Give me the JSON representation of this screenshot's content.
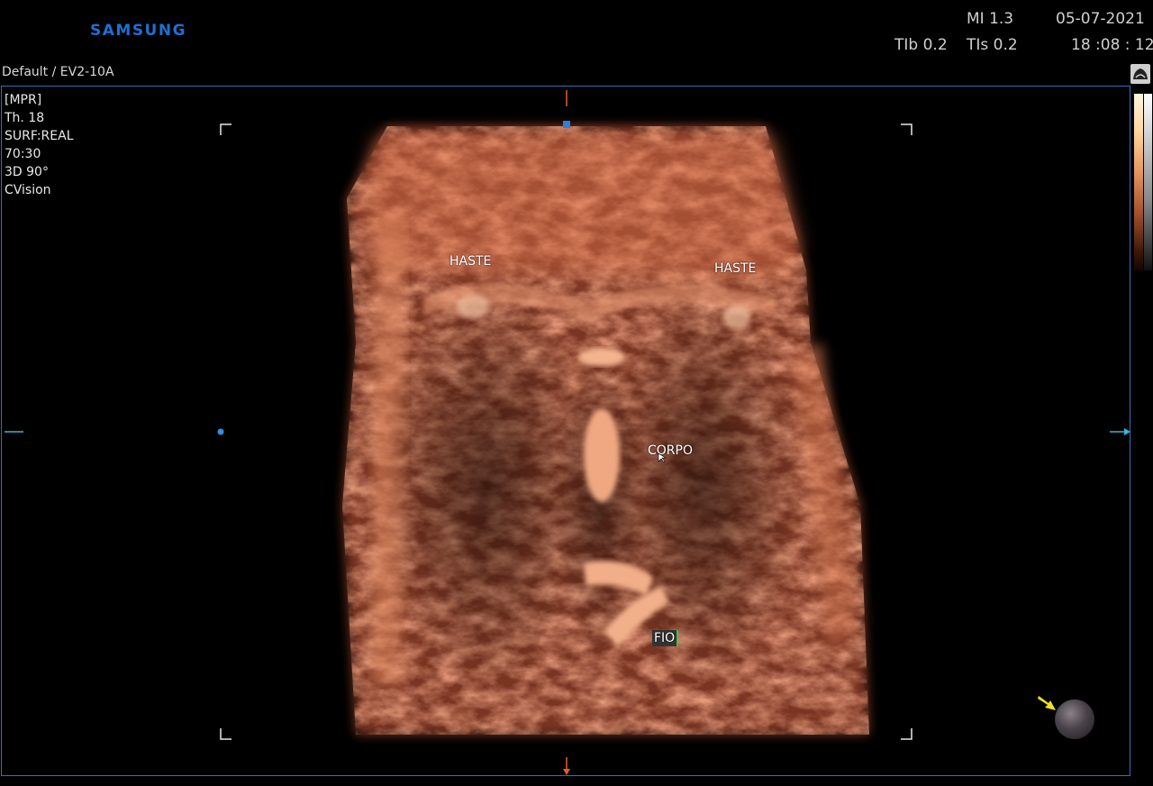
{
  "header": {
    "brand": "SAMSUNG",
    "mi": "MI  1.3",
    "tib": "TIb 0.2",
    "tis": "TIs 0.2",
    "date": "05-07-2021",
    "time": "18 :08 : 12",
    "preset": "Default / EV2-10A"
  },
  "params": {
    "mode": "[MPR]",
    "thickness": "Th. 18",
    "surface": "SURF:REAL",
    "ratio": "70:30",
    "angle": "3D 90°",
    "cvision": "CVision"
  },
  "annotations": {
    "haste_left": "HASTE",
    "haste_right": "HASTE",
    "corpo": "CORPO",
    "fio": "FIO"
  },
  "colors": {
    "brand": "#1f6fd1",
    "frame": "#3b6cb8",
    "cursor": "#f0e020",
    "marker_cyan": "#2fb8e0",
    "marker_orange": "#e0602a"
  },
  "icons": {
    "probe": "probe-icon",
    "orientation": "orientation-ball-icon",
    "pointer": "yellow-arrow-icon"
  }
}
